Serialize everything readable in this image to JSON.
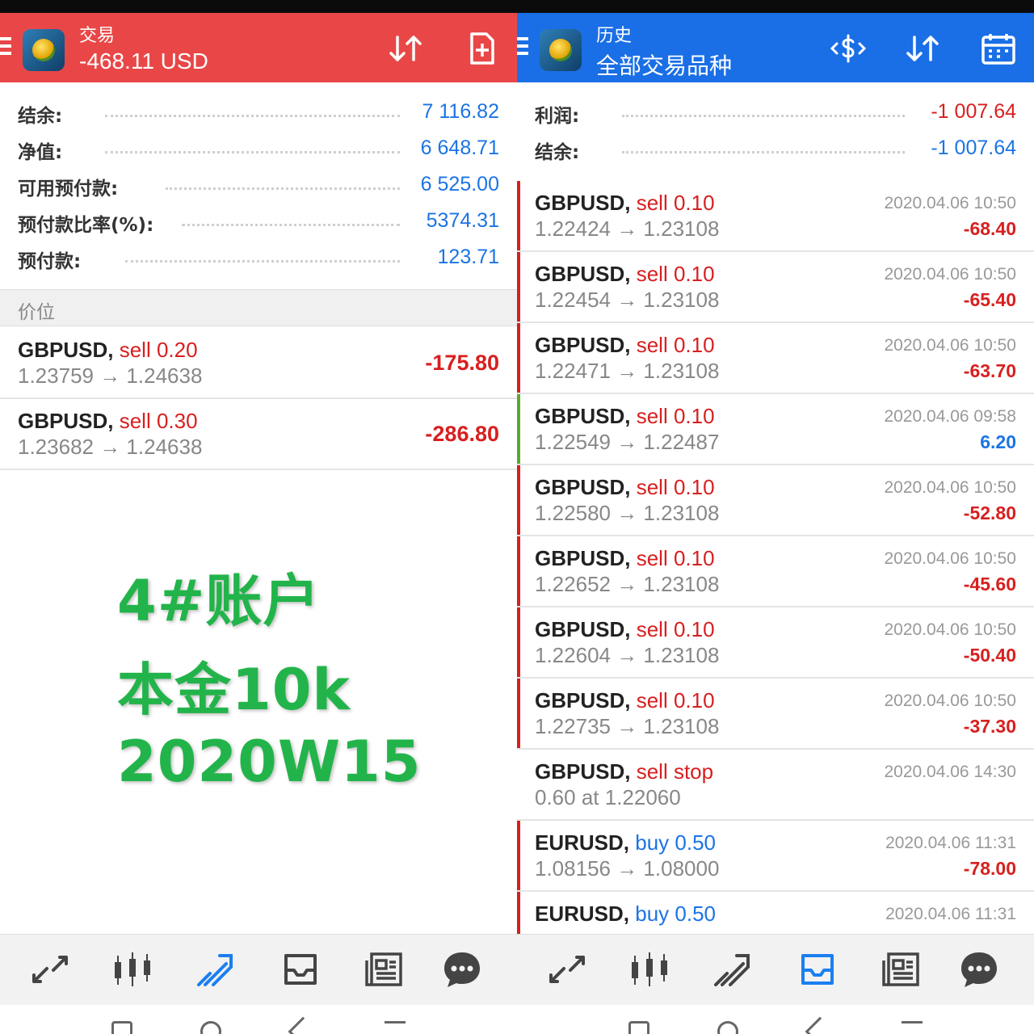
{
  "colors": {
    "trade_header": "#e94747",
    "history_header": "#1a6fe6",
    "loss": "#d81f1f",
    "profit": "#1b74e4",
    "overlay": "#22b44a"
  },
  "left": {
    "header": {
      "top": "交易",
      "main": "-468.11 USD",
      "icons": [
        "sort-icon",
        "new-order-icon"
      ]
    },
    "summary": [
      {
        "label": "结余:",
        "value": "7 116.82"
      },
      {
        "label": "净值:",
        "value": "6 648.71"
      },
      {
        "label": "可用预付款:",
        "value": "6 525.00"
      },
      {
        "label": "预付款比率(%):",
        "value": "5374.31"
      },
      {
        "label": "预付款:",
        "value": "123.71"
      }
    ],
    "section": "价位",
    "positions": [
      {
        "symbol": "GBPUSD,",
        "side": "sell 0.20",
        "prices": "1.23759 → 1.24638",
        "pl": "-175.80"
      },
      {
        "symbol": "GBPUSD,",
        "side": "sell 0.30",
        "prices": "1.23682 → 1.24638",
        "pl": "-286.80"
      }
    ],
    "overlay": [
      "4#账户",
      "本金10k",
      "2020W15"
    ]
  },
  "right": {
    "header": {
      "top": "历史",
      "main": "全部交易品种",
      "icons": [
        "deposit-icon",
        "sort-icon",
        "calendar-icon"
      ]
    },
    "summary": [
      {
        "label": "利润:",
        "value": "-1 007.64"
      },
      {
        "label": "结余:",
        "value": "-1 007.64"
      }
    ],
    "history": [
      {
        "symbol": "GBPUSD,",
        "side": "sell 0.10",
        "prices": "1.22424 → 1.23108",
        "date": "2020.04.06 10:50",
        "pl": "-68.40",
        "kind": "loss"
      },
      {
        "symbol": "GBPUSD,",
        "side": "sell 0.10",
        "prices": "1.22454 → 1.23108",
        "date": "2020.04.06 10:50",
        "pl": "-65.40",
        "kind": "loss"
      },
      {
        "symbol": "GBPUSD,",
        "side": "sell 0.10",
        "prices": "1.22471 → 1.23108",
        "date": "2020.04.06 10:50",
        "pl": "-63.70",
        "kind": "loss"
      },
      {
        "symbol": "GBPUSD,",
        "side": "sell 0.10",
        "prices": "1.22549 → 1.22487",
        "date": "2020.04.06 09:58",
        "pl": "6.20",
        "kind": "profit"
      },
      {
        "symbol": "GBPUSD,",
        "side": "sell 0.10",
        "prices": "1.22580 → 1.23108",
        "date": "2020.04.06 10:50",
        "pl": "-52.80",
        "kind": "loss"
      },
      {
        "symbol": "GBPUSD,",
        "side": "sell 0.10",
        "prices": "1.22652 → 1.23108",
        "date": "2020.04.06 10:50",
        "pl": "-45.60",
        "kind": "loss"
      },
      {
        "symbol": "GBPUSD,",
        "side": "sell 0.10",
        "prices": "1.22604 → 1.23108",
        "date": "2020.04.06 10:50",
        "pl": "-50.40",
        "kind": "loss"
      },
      {
        "symbol": "GBPUSD,",
        "side": "sell 0.10",
        "prices": "1.22735 → 1.23108",
        "date": "2020.04.06 10:50",
        "pl": "-37.30",
        "kind": "loss"
      },
      {
        "symbol": "GBPUSD,",
        "side": "sell stop",
        "prices": "0.60 at 1.22060",
        "date": "2020.04.06 14:30",
        "pl": "",
        "kind": "order"
      },
      {
        "symbol": "EURUSD,",
        "side": "buy 0.50",
        "prices": "1.08156 → 1.08000",
        "date": "2020.04.06 11:31",
        "pl": "-78.00",
        "kind": "loss"
      },
      {
        "symbol": "EURUSD,",
        "side": "buy 0.50",
        "prices": "",
        "date": "2020.04.06 11:31",
        "pl": "",
        "kind": "loss"
      }
    ]
  },
  "nav_icons": [
    "quotes-icon",
    "chart-icon",
    "trade-icon",
    "history-icon",
    "news-icon",
    "chat-icon"
  ],
  "left_active_nav": 2,
  "right_active_nav": 3
}
